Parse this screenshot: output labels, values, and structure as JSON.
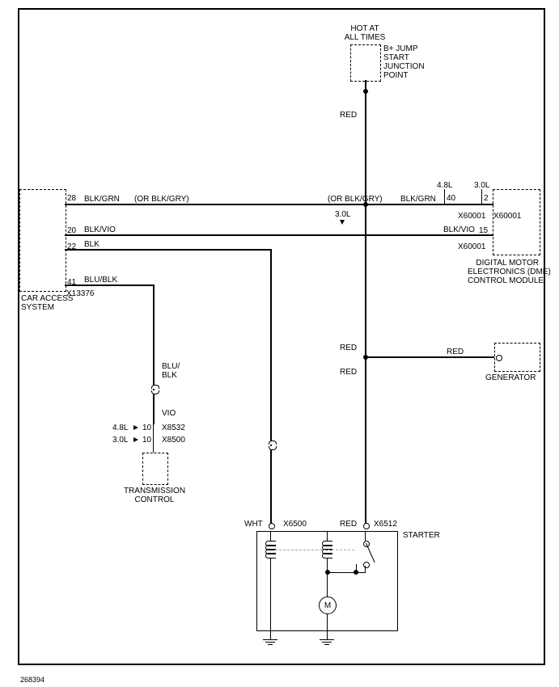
{
  "diagram_id": "268394",
  "header": {
    "hot": "HOT AT\nALL TIMES",
    "junction": "B+ JUMP\nSTART\nJUNCTION\nPOINT"
  },
  "modules": {
    "car_access": {
      "name": "CAR ACCESS\nSYSTEM",
      "connector": "X13376",
      "pins": {
        "p28": "28",
        "p20": "20",
        "p22": "22",
        "p41": "41"
      }
    },
    "dme": {
      "name": "DIGITAL MOTOR\nELECTRONICS (DME)\nCONTROL MODULE",
      "pins": {
        "p40": "40",
        "p2": "2",
        "p15": "15"
      },
      "xa": "X60001",
      "xb": "X60001",
      "xc": "X60001"
    },
    "trans": {
      "name": "TRANSMISSION\nCONTROL",
      "x_a": "X8532",
      "x_b": "X8500",
      "pin_a": "10",
      "pin_b": "10",
      "eng_a": "4.8L",
      "eng_b": "3.0L"
    },
    "starter": {
      "name": "STARTER",
      "xa": "X6500",
      "xb": "X6512"
    },
    "generator": {
      "name": "GENERATOR"
    }
  },
  "wires": {
    "red1": "RED",
    "red2": "RED",
    "red3": "RED",
    "red4": "RED",
    "red5": "RED",
    "blkgrn1": "BLK/GRN",
    "blkgrn2": "BLK/GRN",
    "orblkgry1": "(OR BLK/GRY)",
    "orblkgry2": "(OR BLK/GRY)",
    "blkvio1": "BLK/VIO",
    "blkvio2": "BLK/VIO",
    "blk": "BLK",
    "blublk1": "BLU/BLK",
    "blublk2": "BLU/\nBLK",
    "vio": "VIO",
    "wht": "WHT",
    "eng48": "4.8L",
    "eng30": "3.0L",
    "eng30b": "3.0L"
  },
  "motor_label": "M"
}
